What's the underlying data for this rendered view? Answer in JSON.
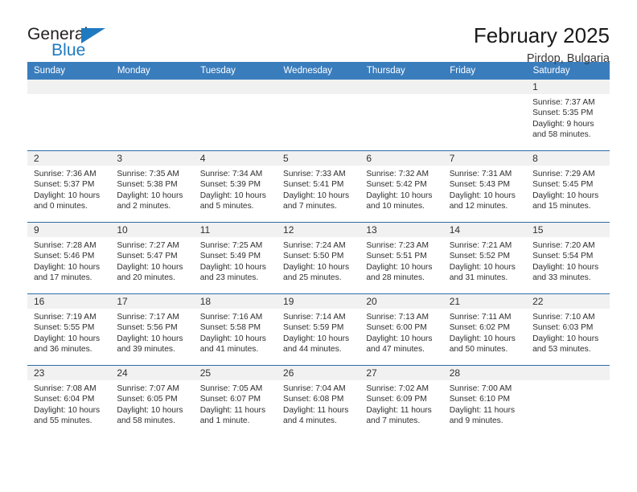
{
  "brand": {
    "name_part1": "General",
    "name_part2": "Blue",
    "accent_color": "#1f7ac0"
  },
  "header": {
    "title": "February 2025",
    "subtitle": "Pirdop, Bulgaria",
    "header_bg_color": "#3a7dbd",
    "daynum_bg_color": "#f1f1f1"
  },
  "weekday_headers": [
    "Sunday",
    "Monday",
    "Tuesday",
    "Wednesday",
    "Thursday",
    "Friday",
    "Saturday"
  ],
  "weeks": [
    [
      {
        "day": "",
        "blank": true,
        "sunrise": "",
        "sunset": "",
        "daylight1": "",
        "daylight2": ""
      },
      {
        "day": "",
        "blank": true,
        "sunrise": "",
        "sunset": "",
        "daylight1": "",
        "daylight2": ""
      },
      {
        "day": "",
        "blank": true,
        "sunrise": "",
        "sunset": "",
        "daylight1": "",
        "daylight2": ""
      },
      {
        "day": "",
        "blank": true,
        "sunrise": "",
        "sunset": "",
        "daylight1": "",
        "daylight2": ""
      },
      {
        "day": "",
        "blank": true,
        "sunrise": "",
        "sunset": "",
        "daylight1": "",
        "daylight2": ""
      },
      {
        "day": "",
        "blank": true,
        "sunrise": "",
        "sunset": "",
        "daylight1": "",
        "daylight2": ""
      },
      {
        "day": "1",
        "sunrise": "Sunrise: 7:37 AM",
        "sunset": "Sunset: 5:35 PM",
        "daylight1": "Daylight: 9 hours",
        "daylight2": "and 58 minutes."
      }
    ],
    [
      {
        "day": "2",
        "sunrise": "Sunrise: 7:36 AM",
        "sunset": "Sunset: 5:37 PM",
        "daylight1": "Daylight: 10 hours",
        "daylight2": "and 0 minutes."
      },
      {
        "day": "3",
        "sunrise": "Sunrise: 7:35 AM",
        "sunset": "Sunset: 5:38 PM",
        "daylight1": "Daylight: 10 hours",
        "daylight2": "and 2 minutes."
      },
      {
        "day": "4",
        "sunrise": "Sunrise: 7:34 AM",
        "sunset": "Sunset: 5:39 PM",
        "daylight1": "Daylight: 10 hours",
        "daylight2": "and 5 minutes."
      },
      {
        "day": "5",
        "sunrise": "Sunrise: 7:33 AM",
        "sunset": "Sunset: 5:41 PM",
        "daylight1": "Daylight: 10 hours",
        "daylight2": "and 7 minutes."
      },
      {
        "day": "6",
        "sunrise": "Sunrise: 7:32 AM",
        "sunset": "Sunset: 5:42 PM",
        "daylight1": "Daylight: 10 hours",
        "daylight2": "and 10 minutes."
      },
      {
        "day": "7",
        "sunrise": "Sunrise: 7:31 AM",
        "sunset": "Sunset: 5:43 PM",
        "daylight1": "Daylight: 10 hours",
        "daylight2": "and 12 minutes."
      },
      {
        "day": "8",
        "sunrise": "Sunrise: 7:29 AM",
        "sunset": "Sunset: 5:45 PM",
        "daylight1": "Daylight: 10 hours",
        "daylight2": "and 15 minutes."
      }
    ],
    [
      {
        "day": "9",
        "sunrise": "Sunrise: 7:28 AM",
        "sunset": "Sunset: 5:46 PM",
        "daylight1": "Daylight: 10 hours",
        "daylight2": "and 17 minutes."
      },
      {
        "day": "10",
        "sunrise": "Sunrise: 7:27 AM",
        "sunset": "Sunset: 5:47 PM",
        "daylight1": "Daylight: 10 hours",
        "daylight2": "and 20 minutes."
      },
      {
        "day": "11",
        "sunrise": "Sunrise: 7:25 AM",
        "sunset": "Sunset: 5:49 PM",
        "daylight1": "Daylight: 10 hours",
        "daylight2": "and 23 minutes."
      },
      {
        "day": "12",
        "sunrise": "Sunrise: 7:24 AM",
        "sunset": "Sunset: 5:50 PM",
        "daylight1": "Daylight: 10 hours",
        "daylight2": "and 25 minutes."
      },
      {
        "day": "13",
        "sunrise": "Sunrise: 7:23 AM",
        "sunset": "Sunset: 5:51 PM",
        "daylight1": "Daylight: 10 hours",
        "daylight2": "and 28 minutes."
      },
      {
        "day": "14",
        "sunrise": "Sunrise: 7:21 AM",
        "sunset": "Sunset: 5:52 PM",
        "daylight1": "Daylight: 10 hours",
        "daylight2": "and 31 minutes."
      },
      {
        "day": "15",
        "sunrise": "Sunrise: 7:20 AM",
        "sunset": "Sunset: 5:54 PM",
        "daylight1": "Daylight: 10 hours",
        "daylight2": "and 33 minutes."
      }
    ],
    [
      {
        "day": "16",
        "sunrise": "Sunrise: 7:19 AM",
        "sunset": "Sunset: 5:55 PM",
        "daylight1": "Daylight: 10 hours",
        "daylight2": "and 36 minutes."
      },
      {
        "day": "17",
        "sunrise": "Sunrise: 7:17 AM",
        "sunset": "Sunset: 5:56 PM",
        "daylight1": "Daylight: 10 hours",
        "daylight2": "and 39 minutes."
      },
      {
        "day": "18",
        "sunrise": "Sunrise: 7:16 AM",
        "sunset": "Sunset: 5:58 PM",
        "daylight1": "Daylight: 10 hours",
        "daylight2": "and 41 minutes."
      },
      {
        "day": "19",
        "sunrise": "Sunrise: 7:14 AM",
        "sunset": "Sunset: 5:59 PM",
        "daylight1": "Daylight: 10 hours",
        "daylight2": "and 44 minutes."
      },
      {
        "day": "20",
        "sunrise": "Sunrise: 7:13 AM",
        "sunset": "Sunset: 6:00 PM",
        "daylight1": "Daylight: 10 hours",
        "daylight2": "and 47 minutes."
      },
      {
        "day": "21",
        "sunrise": "Sunrise: 7:11 AM",
        "sunset": "Sunset: 6:02 PM",
        "daylight1": "Daylight: 10 hours",
        "daylight2": "and 50 minutes."
      },
      {
        "day": "22",
        "sunrise": "Sunrise: 7:10 AM",
        "sunset": "Sunset: 6:03 PM",
        "daylight1": "Daylight: 10 hours",
        "daylight2": "and 53 minutes."
      }
    ],
    [
      {
        "day": "23",
        "sunrise": "Sunrise: 7:08 AM",
        "sunset": "Sunset: 6:04 PM",
        "daylight1": "Daylight: 10 hours",
        "daylight2": "and 55 minutes."
      },
      {
        "day": "24",
        "sunrise": "Sunrise: 7:07 AM",
        "sunset": "Sunset: 6:05 PM",
        "daylight1": "Daylight: 10 hours",
        "daylight2": "and 58 minutes."
      },
      {
        "day": "25",
        "sunrise": "Sunrise: 7:05 AM",
        "sunset": "Sunset: 6:07 PM",
        "daylight1": "Daylight: 11 hours",
        "daylight2": "and 1 minute."
      },
      {
        "day": "26",
        "sunrise": "Sunrise: 7:04 AM",
        "sunset": "Sunset: 6:08 PM",
        "daylight1": "Daylight: 11 hours",
        "daylight2": "and 4 minutes."
      },
      {
        "day": "27",
        "sunrise": "Sunrise: 7:02 AM",
        "sunset": "Sunset: 6:09 PM",
        "daylight1": "Daylight: 11 hours",
        "daylight2": "and 7 minutes."
      },
      {
        "day": "28",
        "sunrise": "Sunrise: 7:00 AM",
        "sunset": "Sunset: 6:10 PM",
        "daylight1": "Daylight: 11 hours",
        "daylight2": "and 9 minutes."
      },
      {
        "day": "",
        "blank": true,
        "sunrise": "",
        "sunset": "",
        "daylight1": "",
        "daylight2": ""
      }
    ]
  ]
}
